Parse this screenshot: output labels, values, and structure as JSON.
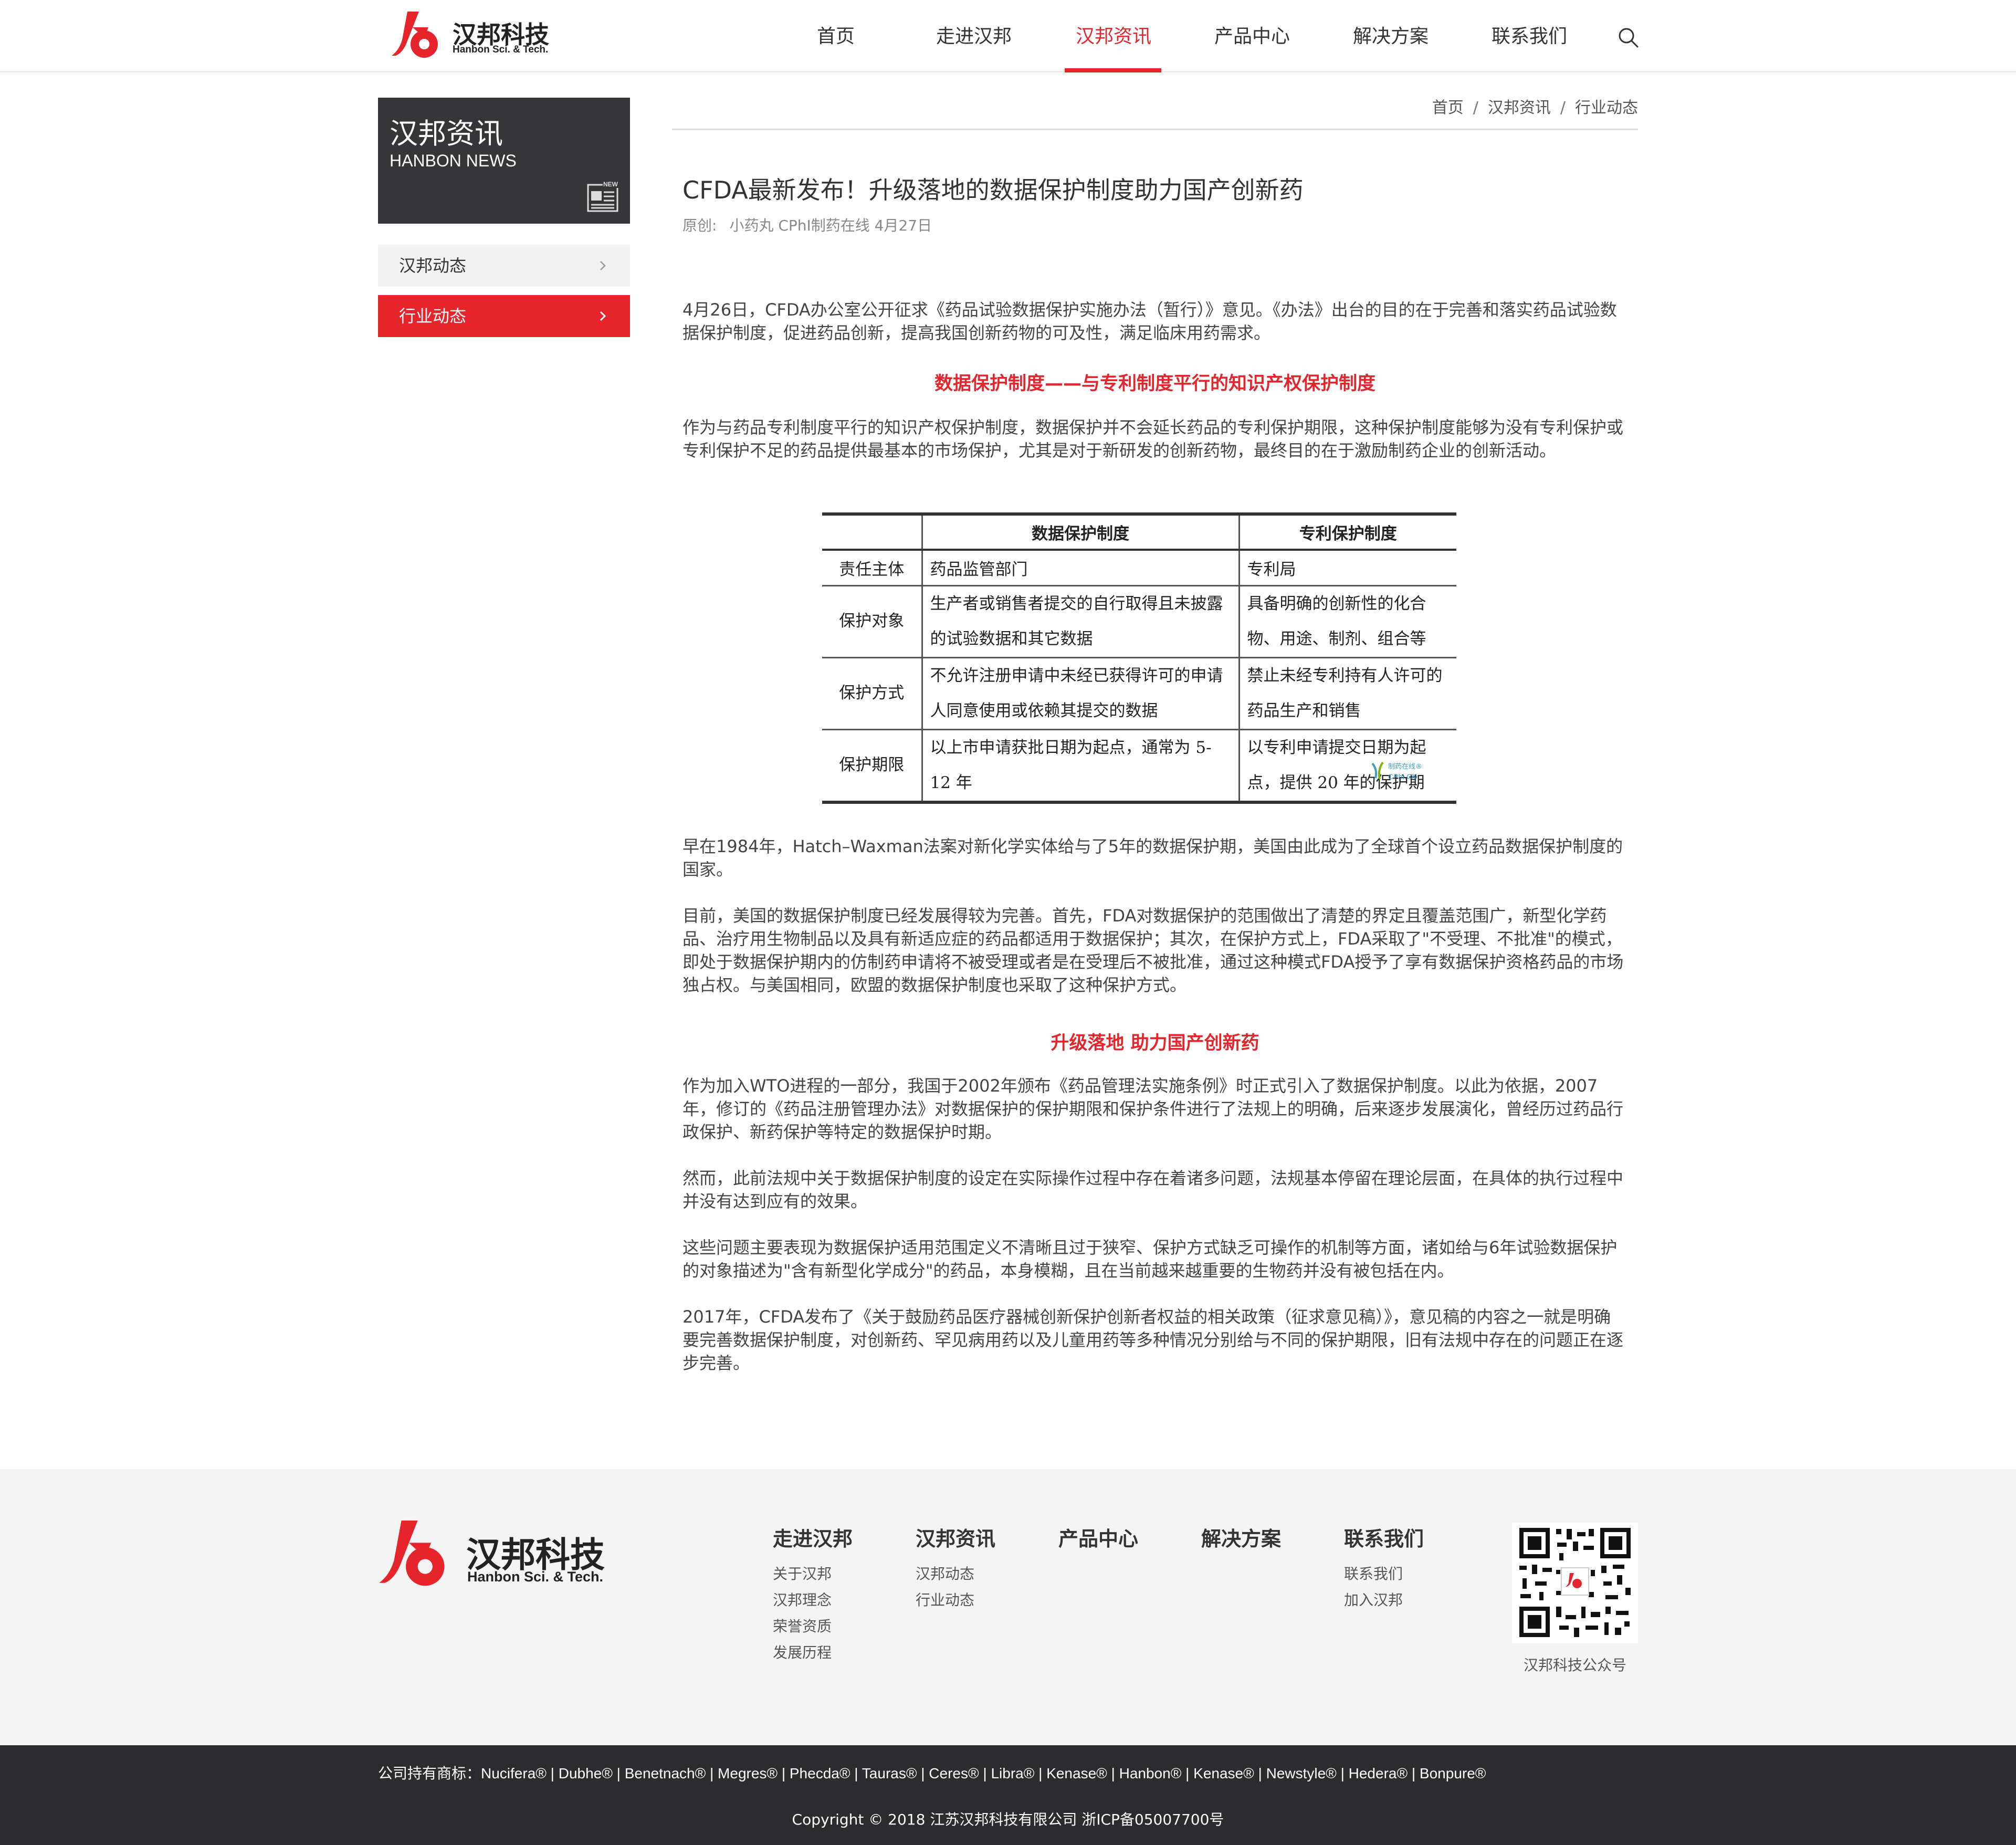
{
  "header": {
    "logo_cn": "汉邦科技",
    "logo_en": "Hanbon Sci. & Tech.",
    "nav": [
      {
        "label": "首页"
      },
      {
        "label": "走进汉邦"
      },
      {
        "label": "汉邦资讯"
      },
      {
        "label": "产品中心"
      },
      {
        "label": "解决方案"
      },
      {
        "label": "联系我们"
      }
    ],
    "active_nav": "汉邦资讯"
  },
  "sidebar": {
    "title": "汉邦资讯",
    "subtitle": "HANBON NEWS",
    "icon_text": "NEW",
    "items": [
      {
        "label": "汉邦动态",
        "active": false
      },
      {
        "label": "行业动态",
        "active": true
      }
    ]
  },
  "breadcrumb": {
    "items": [
      "首页",
      "汉邦资讯",
      "行业动态"
    ],
    "separator": "/"
  },
  "article": {
    "title": "CFDA最新发布！升级落地的数据保护制度助力国产创新药",
    "meta_original": "原创:",
    "meta_author": "小药丸 CPhI制药在线 4月27日",
    "p1": "4月26日，CFDA办公室公开征求《药品试验数据保护实施办法（暂行）》意见。《办法》出台的目的在于完善和落实药品试验数据保护制度，促进药品创新，提高我国创新药物的可及性，满足临床用药需求。",
    "subhead1": "数据保护制度——与专利制度平行的知识产权保护制度",
    "p2": "作为与药品专利制度平行的知识产权保护制度，数据保护并不会延长药品的专利保护期限，这种保护制度能够为没有专利保护或专利保护不足的药品提供最基本的市场保护，尤其是对于新研发的创新药物，最终目的在于激励制药企业的创新活动。",
    "table": {
      "headers": [
        "",
        "数据保护制度",
        "专利保护制度"
      ],
      "rows": [
        {
          "label": "责任主体",
          "data": "药品监管部门",
          "patent": "专利局"
        },
        {
          "label": "保护对象",
          "data": "生产者或销售者提交的自行取得且未披露的试验数据和其它数据",
          "patent": "具备明确的创新性的化合物、用途、制剂、组合等"
        },
        {
          "label": "保护方式",
          "data": "不允许注册申请中未经已获得许可的申请人同意使用或依赖其提交的数据",
          "patent": "禁止未经专利持有人许可的药品生产和销售"
        },
        {
          "label": "保护期限",
          "data": "以上市申请获批日期为起点，通常为 5-12 年",
          "patent": "以专利申请提交日期为起点，提供 20 年的保护期"
        }
      ],
      "watermark_cn": "制药在线®",
      "watermark_en": "CPhI.CN"
    },
    "p3": "早在1984年，Hatch–Waxman法案对新化学实体给与了5年的数据保护期，美国由此成为了全球首个设立药品数据保护制度的国家。",
    "p4": "目前，美国的数据保护制度已经发展得较为完善。首先，FDA对数据保护的范围做出了清楚的界定且覆盖范围广，新型化学药品、治疗用生物制品以及具有新适应症的药品都适用于数据保护；其次，在保护方式上，FDA采取了\"不受理、不批准\"的模式，即处于数据保护期内的仿制药申请将不被受理或者是在受理后不被批准，通过这种模式FDA授予了享有数据保护资格药品的市场独占权。与美国相同，欧盟的数据保护制度也采取了这种保护方式。",
    "subhead2": "升级落地 助力国产创新药",
    "p5": "作为加入WTO进程的一部分，我国于2002年颁布《药品管理法实施条例》时正式引入了数据保护制度。以此为依据，2007年，修订的《药品注册管理办法》对数据保护的保护期限和保护条件进行了法规上的明确，后来逐步发展演化，曾经历过药品行政保护、新药保护等特定的数据保护时期。",
    "p6": "然而，此前法规中关于数据保护制度的设定在实际操作过程中存在着诸多问题，法规基本停留在理论层面，在具体的执行过程中并没有达到应有的效果。",
    "p7": "这些问题主要表现为数据保护适用范围定义不清晰且过于狭窄、保护方式缺乏可操作的机制等方面，诸如给与6年试验数据保护的对象描述为\"含有新型化学成分\"的药品，本身模糊，且在当前越来越重要的生物药并没有被包括在内。",
    "p8": "2017年，CFDA发布了《关于鼓励药品医疗器械创新保护创新者权益的相关政策（征求意见稿）》，意见稿的内容之一就是明确要完善数据保护制度，对创新药、罕见病用药以及儿童用药等多种情况分别给与不同的保护期限，旧有法规中存在的问题正在逐步完善。"
  },
  "footer": {
    "logo_cn": "汉邦科技",
    "logo_en": "Hanbon Sci. & Tech.",
    "columns": [
      {
        "title": "走进汉邦",
        "links": [
          "关于汉邦",
          "汉邦理念",
          "荣誉资质",
          "发展历程"
        ]
      },
      {
        "title": "汉邦资讯",
        "links": [
          "汉邦动态",
          "行业动态"
        ]
      },
      {
        "title": "产品中心",
        "links": []
      },
      {
        "title": "解决方案",
        "links": []
      },
      {
        "title": "联系我们",
        "links": [
          "联系我们",
          "加入汉邦"
        ]
      }
    ],
    "qr_label": "汉邦科技公众号",
    "trademarks": "公司持有商标：Nucifera®  |  Dubhe®  |  Benetnach®  |  Megres®  |  Phecda®  |  Tauras®  |  Ceres®  |  Libra®  |  Kenase®  |  Hanbon®  |  Kenase®  |  Newstyle®  |  Hedera® | Bonpure®",
    "copyright": "Copyright © 2018 江苏汉邦科技有限公司 浙ICP备05007700号"
  },
  "colors": {
    "brand_red": "#e5242c",
    "dark_banner": "#363638",
    "footer_bg": "#f4f4f5",
    "bottom_bar": "#2c2c2e"
  }
}
